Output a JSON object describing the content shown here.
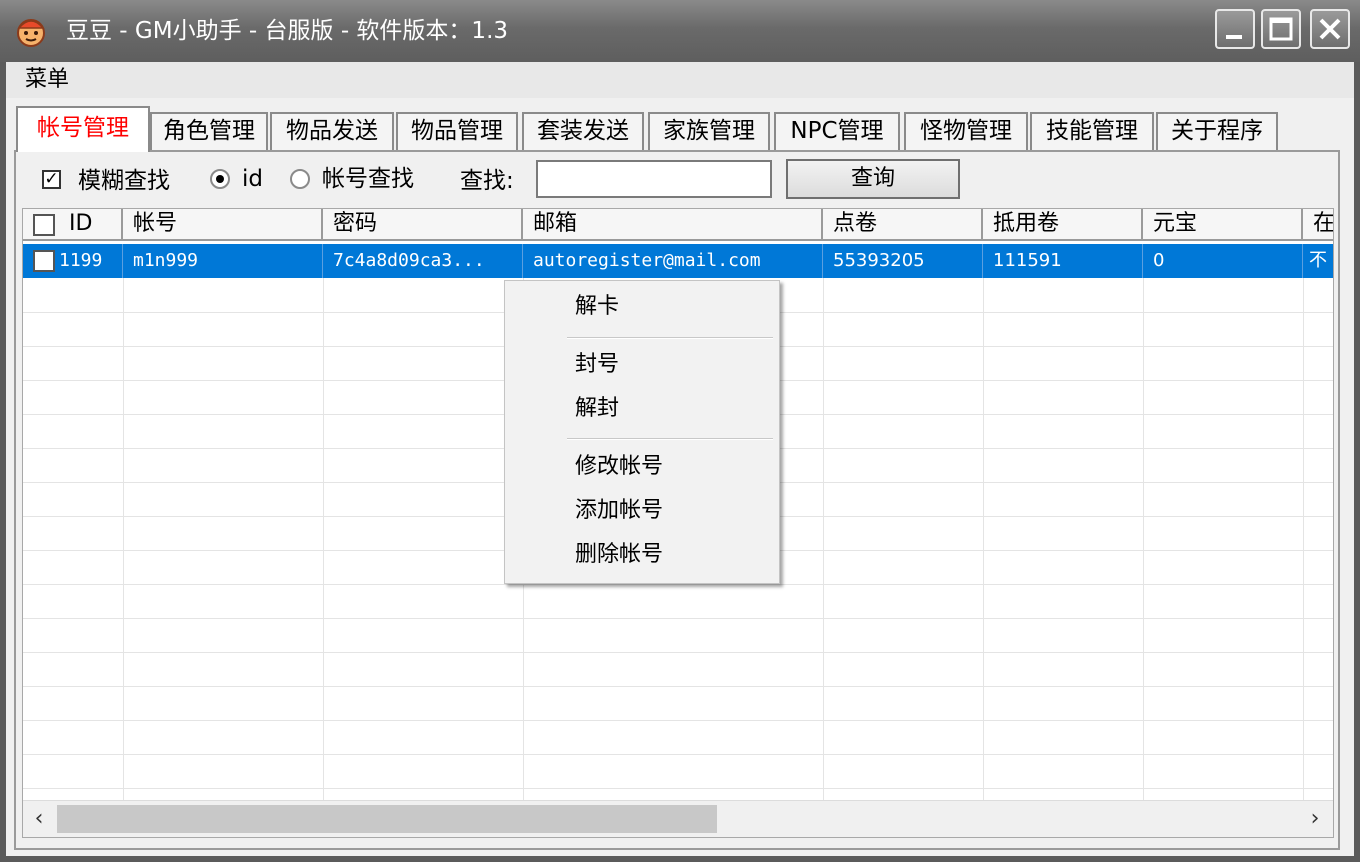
{
  "window": {
    "title": "豆豆 - GM小助手 - 台服版 - 软件版本：1.3"
  },
  "menubar": {
    "items": [
      {
        "label": "菜单"
      }
    ]
  },
  "tabs": [
    {
      "label": "帐号管理",
      "active": true
    },
    {
      "label": "角色管理"
    },
    {
      "label": "物品发送"
    },
    {
      "label": "物品管理"
    },
    {
      "label": "套装发送"
    },
    {
      "label": "家族管理"
    },
    {
      "label": "NPC管理"
    },
    {
      "label": "怪物管理"
    },
    {
      "label": "技能管理"
    },
    {
      "label": "关于程序"
    }
  ],
  "search": {
    "fuzzy_label": "模糊查找",
    "fuzzy_checked": true,
    "radio_id_label": "id",
    "radio_id_selected": true,
    "radio_account_label": "帐号查找",
    "find_label": "查找:",
    "value": "",
    "query_button": "查询"
  },
  "table": {
    "columns": [
      "ID",
      "帐号",
      "密码",
      "邮箱",
      "点卷",
      "抵用卷",
      "元宝",
      "在"
    ],
    "rows": [
      {
        "id": "1199",
        "account": "m1n999",
        "password": "7c4a8d09ca3...",
        "email": "autoregister@mail.com",
        "points": "55393205",
        "voucher": "111591",
        "yuanbao": "0",
        "online": "不",
        "selected": true
      }
    ]
  },
  "context_menu": {
    "items": [
      "解卡",
      "封号",
      "解封",
      "修改帐号",
      "添加帐号",
      "删除帐号"
    ]
  },
  "colors": {
    "selection": "#0078d7",
    "active_tab_text": "#ff0000",
    "title_bar": "#6a6a6a"
  }
}
